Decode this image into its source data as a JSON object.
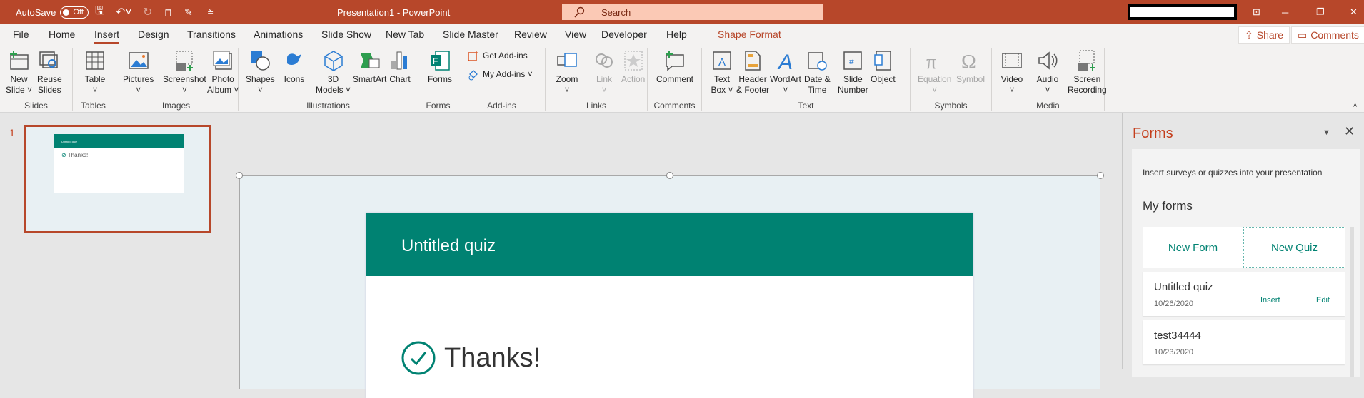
{
  "titlebar": {
    "autosave": "AutoSave",
    "autosave_state": "Off",
    "title": "Presentation1  -  PowerPoint",
    "search_placeholder": "Search"
  },
  "tabs": [
    {
      "label": "File"
    },
    {
      "label": "Home"
    },
    {
      "label": "Insert",
      "active": true
    },
    {
      "label": "Design"
    },
    {
      "label": "Transitions"
    },
    {
      "label": "Animations"
    },
    {
      "label": "Slide Show"
    },
    {
      "label": "New Tab"
    },
    {
      "label": "Slide Master"
    },
    {
      "label": "Review"
    },
    {
      "label": "View"
    },
    {
      "label": "Developer"
    },
    {
      "label": "Help"
    },
    {
      "label": "Shape Format",
      "contextual": true
    }
  ],
  "share_label": "Share",
  "comments_label": "Comments",
  "ribbon": {
    "groups": [
      {
        "label": "Slides",
        "buttons": [
          {
            "l1": "New",
            "l2": "Slide ˅",
            "icon": "new-slide"
          },
          {
            "l1": "Reuse",
            "l2": "Slides",
            "icon": "reuse-slides"
          }
        ]
      },
      {
        "label": "Tables",
        "buttons": [
          {
            "l1": "Table",
            "l2": "˅",
            "icon": "table"
          }
        ]
      },
      {
        "label": "Images",
        "buttons": [
          {
            "l1": "Pictures",
            "l2": "˅",
            "icon": "pictures"
          },
          {
            "l1": "Screenshot",
            "l2": "˅",
            "icon": "screenshot"
          },
          {
            "l1": "Photo",
            "l2": "Album ˅",
            "icon": "photo-album"
          }
        ]
      },
      {
        "label": "Illustrations",
        "buttons": [
          {
            "l1": "Shapes",
            "l2": "˅",
            "icon": "shapes"
          },
          {
            "l1": "Icons",
            "l2": "",
            "icon": "icons"
          },
          {
            "l1": "3D",
            "l2": "Models ˅",
            "icon": "3d-models"
          },
          {
            "l1": "SmartArt",
            "l2": "",
            "icon": "smartart"
          },
          {
            "l1": "Chart",
            "l2": "",
            "icon": "chart"
          }
        ]
      },
      {
        "label": "Forms",
        "buttons": [
          {
            "l1": "Forms",
            "l2": "",
            "icon": "forms"
          }
        ]
      },
      {
        "label": "Add-ins",
        "small": [
          {
            "label": "Get Add-ins",
            "icon": "get-addins"
          },
          {
            "label": "My Add-ins  ˅",
            "icon": "my-addins"
          }
        ]
      },
      {
        "label": "Links",
        "buttons": [
          {
            "l1": "Zoom",
            "l2": "˅",
            "icon": "zoom"
          },
          {
            "l1": "Link",
            "l2": "˅",
            "icon": "link",
            "disabled": true
          },
          {
            "l1": "Action",
            "l2": "",
            "icon": "action",
            "disabled": true
          }
        ]
      },
      {
        "label": "Comments",
        "buttons": [
          {
            "l1": "Comment",
            "l2": "",
            "icon": "comment"
          }
        ]
      },
      {
        "label": "Text",
        "buttons": [
          {
            "l1": "Text",
            "l2": "Box ˅",
            "icon": "text-box"
          },
          {
            "l1": "Header",
            "l2": "& Footer",
            "icon": "header-footer"
          },
          {
            "l1": "WordArt",
            "l2": "˅",
            "icon": "wordart"
          },
          {
            "l1": "Date &",
            "l2": "Time",
            "icon": "date-time"
          },
          {
            "l1": "Slide",
            "l2": "Number",
            "icon": "slide-number"
          },
          {
            "l1": "Object",
            "l2": "",
            "icon": "object"
          }
        ]
      },
      {
        "label": "Symbols",
        "buttons": [
          {
            "l1": "Equation",
            "l2": "˅",
            "icon": "equation",
            "disabled": true
          },
          {
            "l1": "Symbol",
            "l2": "",
            "icon": "symbol",
            "disabled": true
          }
        ]
      },
      {
        "label": "Media",
        "buttons": [
          {
            "l1": "Video",
            "l2": "˅",
            "icon": "video"
          },
          {
            "l1": "Audio",
            "l2": "˅",
            "icon": "audio"
          },
          {
            "l1": "Screen",
            "l2": "Recording",
            "icon": "screen-recording"
          }
        ]
      }
    ]
  },
  "thumbnails": [
    {
      "number": "1",
      "title": "Untitled quiz"
    }
  ],
  "slide": {
    "quiz_title": "Untitled quiz",
    "thanks": "Thanks!"
  },
  "pane": {
    "title": "Forms",
    "info": "Insert surveys or quizzes into your presentation",
    "my_forms": "My forms",
    "new_form": "New Form",
    "new_quiz": "New Quiz",
    "items": [
      {
        "name": "Untitled quiz",
        "date": "10/26/2020",
        "insert": "Insert",
        "edit": "Edit"
      },
      {
        "name": "test34444",
        "date": "10/23/2020"
      }
    ]
  },
  "colors": {
    "accent": "#b7472a",
    "forms_green": "#008272"
  }
}
